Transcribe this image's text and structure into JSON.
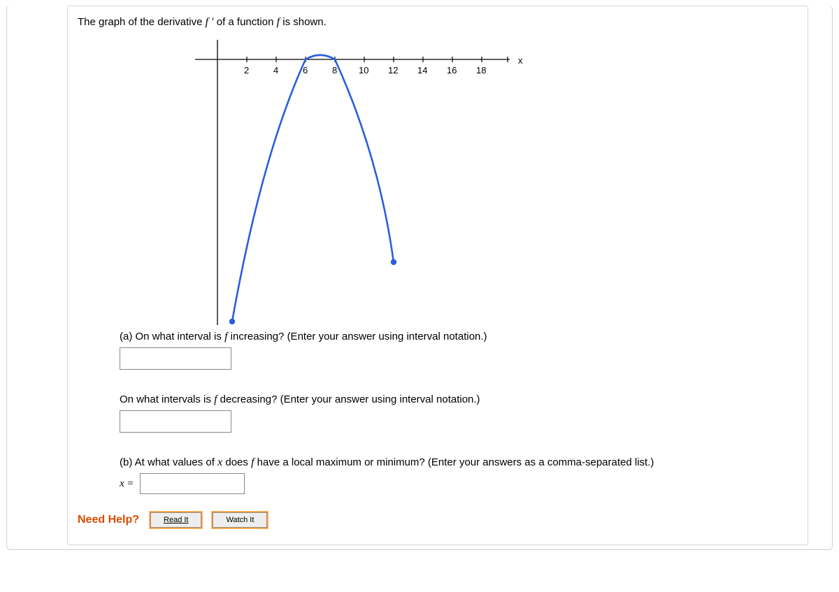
{
  "prompt_pre": "The graph of the derivative ",
  "prompt_fprime": "f ′",
  "prompt_mid": " of a function ",
  "prompt_f": "f",
  "prompt_post": " is shown.",
  "chart_data": {
    "type": "line",
    "xlabel": "x",
    "xlim": [
      -1,
      19
    ],
    "ylim": [
      -15,
      1
    ],
    "x_ticks": [
      2,
      4,
      6,
      8,
      10,
      12,
      14,
      16,
      18
    ],
    "series": [
      {
        "name": "f'(x)",
        "x": [
          1,
          2,
          3,
          4,
          5,
          6,
          7,
          8,
          9,
          10,
          11,
          12
        ],
        "values": [
          -15,
          -10.9,
          -7.1,
          -3.9,
          -1.5,
          0,
          0.5,
          0,
          -1.5,
          -3.9,
          -7.1,
          -11.6
        ]
      }
    ],
    "endpoints": [
      {
        "x": 1,
        "y": -15
      },
      {
        "x": 12,
        "y": -11.6
      }
    ]
  },
  "q_a_pre": "(a) On what interval is ",
  "q_a_f": "f",
  "q_a_post": " increasing? (Enter your answer using interval notation.)",
  "q_a2_pre": "On what intervals is ",
  "q_a2_f": "f",
  "q_a2_post": " decreasing? (Enter your answer using interval notation.)",
  "q_b_pre": "(b) At what values of ",
  "q_b_x": "x",
  "q_b_mid": " does  ",
  "q_b_f": "f",
  "q_b_post": " have a local maximum or minimum? (Enter your answers as a comma-separated list.)",
  "x_eq": "x =",
  "need_help": "Need Help?",
  "read_it": "Read It",
  "watch_it": "Watch It"
}
